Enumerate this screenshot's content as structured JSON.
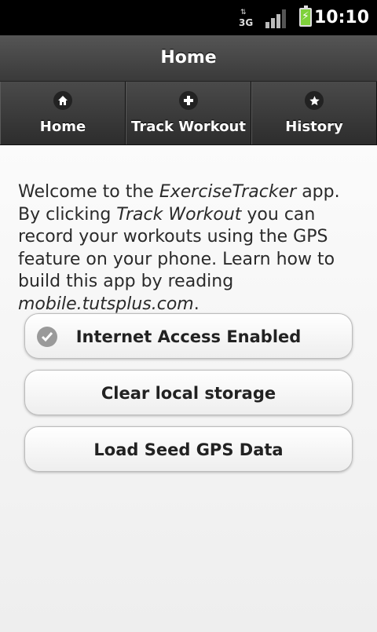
{
  "statusbar": {
    "network": "3G",
    "time": "10:10"
  },
  "header": {
    "title": "Home"
  },
  "nav": {
    "items": [
      {
        "label": "Home",
        "icon": "home-icon"
      },
      {
        "label": "Track Workout",
        "icon": "plus-icon"
      },
      {
        "label": "History",
        "icon": "star-icon"
      }
    ]
  },
  "intro": {
    "part1": "Welcome to the ",
    "app_name": "ExerciseTracker",
    "part2": " app. By clicking ",
    "track_label": "Track Workout",
    "part3": " you can record your workouts using the GPS feature on your phone. Learn how to build this app by reading ",
    "site": "mobile.tutsplus.com",
    "part4": "."
  },
  "buttons": {
    "internet": "Internet Access Enabled",
    "clear": "Clear local storage",
    "seed": "Load Seed GPS Data"
  },
  "colors": {
    "battery": "#7fd13b",
    "header_bg": "#444444",
    "content_bg": "#f3f3f3"
  }
}
